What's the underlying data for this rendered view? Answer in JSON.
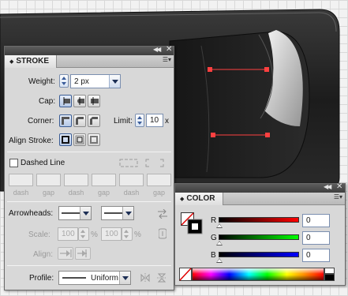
{
  "stroke_panel": {
    "title": "STROKE",
    "weight_label": "Weight:",
    "weight_value": "2 px",
    "cap_label": "Cap:",
    "corner_label": "Corner:",
    "limit_label": "Limit:",
    "limit_value": "10",
    "limit_unit": "x",
    "align_label": "Align Stroke:",
    "dashed_line_label": "Dashed Line",
    "dash_labels": [
      "dash",
      "gap",
      "dash",
      "gap",
      "dash",
      "gap"
    ],
    "arrowheads_label": "Arrowheads:",
    "scale_label": "Scale:",
    "scale_start": "100",
    "scale_end": "100",
    "percent": "%",
    "align_arrow_label": "Align:",
    "profile_label": "Profile:",
    "profile_value": "Uniform"
  },
  "color_panel": {
    "title": "COLOR",
    "channels": [
      {
        "label": "R",
        "value": "0",
        "track_color": "#cc0000"
      },
      {
        "label": "G",
        "value": "0",
        "track_color": "#00cc00"
      },
      {
        "label": "B",
        "value": "0",
        "track_color": "#0000cc"
      }
    ],
    "fill_color": "#ffffff",
    "stroke_color": "#000000"
  },
  "colors": {
    "panel_bg": "#d8d8d8",
    "titlebar": "#4a4a4a",
    "path_red": "#ff4040",
    "artwork_dark": "#1e1e1e"
  }
}
